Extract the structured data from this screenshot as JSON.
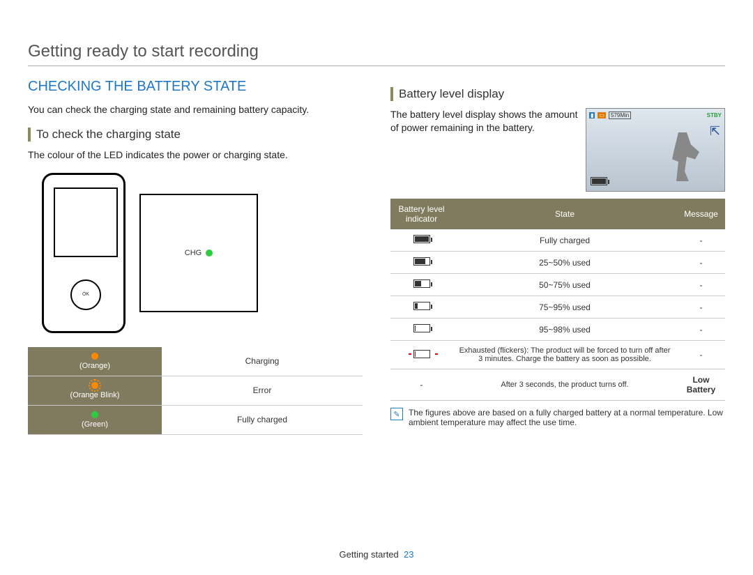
{
  "page_title": "Getting ready to start recording",
  "section_heading": "CHECKING THE BATTERY STATE",
  "intro_text": "You can check the charging state and remaining battery capacity.",
  "left": {
    "subhead": "To check the charging state",
    "desc": "The colour of the LED indicates the power or charging state.",
    "chg_label": "CHG",
    "charge_rows": [
      {
        "led_label": "(Orange)",
        "state": "Charging"
      },
      {
        "led_label": "(Orange Blink)",
        "state": "Error"
      },
      {
        "led_label": "(Green)",
        "state": "Fully charged"
      }
    ]
  },
  "right": {
    "subhead": "Battery level display",
    "desc": "The battery level display shows the amount of power remaining in the battery.",
    "preview_time": "579Min",
    "preview_stby": "STBY",
    "table_headers": {
      "c0": "Battery level indicator",
      "c1": "State",
      "c2": "Message"
    },
    "rows": [
      {
        "fill": 100,
        "state": "Fully charged",
        "msg": "-"
      },
      {
        "fill": 70,
        "state": "25~50% used",
        "msg": "-"
      },
      {
        "fill": 45,
        "state": "50~75% used",
        "msg": "-"
      },
      {
        "fill": 20,
        "state": "75~95% used",
        "msg": "-"
      },
      {
        "fill": 8,
        "state": "95~98% used",
        "msg": "-"
      },
      {
        "fill": 5,
        "state": "Exhausted (flickers): The product will be forced to turn off after 3 minutes. Charge the battery as soon as possible.",
        "msg": "-",
        "red": true,
        "flicker": true
      },
      {
        "fill": 0,
        "state": "After 3 seconds, the product turns off.",
        "msg": "Low Battery",
        "dash_icon": true
      }
    ],
    "note": "The figures above are based on a fully charged battery at a normal temperature. Low ambient temperature may affect the use time."
  },
  "footer": {
    "label": "Getting started",
    "page_num": "23"
  }
}
